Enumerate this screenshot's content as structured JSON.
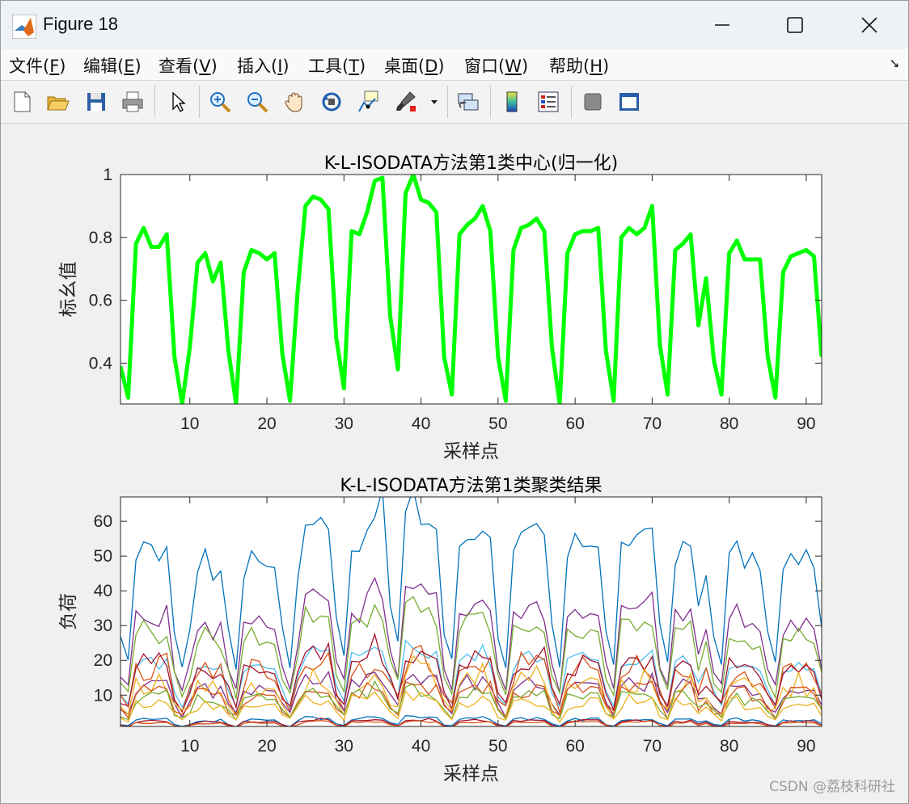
{
  "window": {
    "title": "Figure 18",
    "controls": {
      "minimize": "minimize",
      "maximize": "maximize",
      "close": "close"
    }
  },
  "menu": [
    {
      "label": "文件(",
      "key": "F",
      "tail": ")"
    },
    {
      "label": "编辑(",
      "key": "E",
      "tail": ")"
    },
    {
      "label": "查看(",
      "key": "V",
      "tail": ")"
    },
    {
      "label": "插入(",
      "key": "I",
      "tail": ")"
    },
    {
      "label": "工具(",
      "key": "T",
      "tail": ")"
    },
    {
      "label": "桌面(",
      "key": "D",
      "tail": ")"
    },
    {
      "label": "窗口(",
      "key": "W",
      "tail": ")"
    },
    {
      "label": "帮助(",
      "key": "H",
      "tail": ")"
    }
  ],
  "toolbar": [
    "new-figure-icon",
    "open-file-icon",
    "save-icon",
    "print-icon",
    "pointer-icon",
    "zoom-in-icon",
    "zoom-out-icon",
    "pan-icon",
    "rotate-3d-icon",
    "data-cursor-icon",
    "brush-icon",
    "link-plot-icon",
    "colorbar-icon",
    "legend-icon",
    "hide-plot-tools-icon",
    "show-plot-tools-icon"
  ],
  "watermark": "CSDN @荔枝科研社",
  "chart_data": [
    {
      "type": "line",
      "title": "K-L-ISODATA方法第1类中心(归一化)",
      "xlabel": "采样点",
      "ylabel": "标幺值",
      "xlim": [
        1,
        92
      ],
      "ylim": [
        0.27,
        1.0
      ],
      "xticks": [
        10,
        20,
        30,
        40,
        50,
        60,
        70,
        80,
        90
      ],
      "yticks": [
        0.4,
        0.6,
        0.8,
        1
      ],
      "ytick_labels": [
        "0.4",
        "0.6",
        "0.8",
        "1"
      ],
      "grid": false,
      "color": "#00ff00",
      "x": [
        1,
        2,
        3,
        4,
        5,
        6,
        7,
        8,
        9,
        10,
        11,
        12,
        13,
        14,
        15,
        16,
        17,
        18,
        19,
        20,
        21,
        22,
        23,
        24,
        25,
        26,
        27,
        28,
        29,
        30,
        31,
        32,
        33,
        34,
        35,
        36,
        37,
        38,
        39,
        40,
        41,
        42,
        43,
        44,
        45,
        46,
        47,
        48,
        49,
        50,
        51,
        52,
        53,
        54,
        55,
        56,
        57,
        58,
        59,
        60,
        61,
        62,
        63,
        64,
        65,
        66,
        67,
        68,
        69,
        70,
        71,
        72,
        73,
        74,
        75,
        76,
        77,
        78,
        79,
        80,
        81,
        82,
        83,
        84,
        85,
        86,
        87,
        88,
        89,
        90,
        91,
        92
      ],
      "values": [
        0.39,
        0.29,
        0.78,
        0.83,
        0.77,
        0.77,
        0.81,
        0.42,
        0.27,
        0.45,
        0.72,
        0.75,
        0.66,
        0.72,
        0.44,
        0.27,
        0.69,
        0.76,
        0.75,
        0.73,
        0.75,
        0.43,
        0.28,
        0.63,
        0.9,
        0.93,
        0.92,
        0.89,
        0.48,
        0.32,
        0.82,
        0.81,
        0.88,
        0.98,
        0.99,
        0.55,
        0.38,
        0.94,
        1.0,
        0.92,
        0.91,
        0.88,
        0.42,
        0.3,
        0.81,
        0.84,
        0.86,
        0.9,
        0.82,
        0.42,
        0.28,
        0.76,
        0.83,
        0.84,
        0.86,
        0.82,
        0.45,
        0.27,
        0.75,
        0.81,
        0.82,
        0.82,
        0.83,
        0.44,
        0.28,
        0.8,
        0.83,
        0.81,
        0.83,
        0.9,
        0.46,
        0.3,
        0.76,
        0.78,
        0.81,
        0.52,
        0.67,
        0.41,
        0.3,
        0.75,
        0.79,
        0.73,
        0.73,
        0.73,
        0.42,
        0.29,
        0.69,
        0.74,
        0.75,
        0.76,
        0.74,
        0.42
      ]
    },
    {
      "type": "line",
      "title": "K-L-ISODATA方法第1类聚类结果",
      "xlabel": "采样点",
      "ylabel": "负荷",
      "xlim": [
        1,
        92
      ],
      "ylim": [
        1,
        67
      ],
      "xticks": [
        10,
        20,
        30,
        40,
        50,
        60,
        70,
        80,
        90
      ],
      "yticks": [
        10,
        20,
        30,
        40,
        50,
        60
      ],
      "grid": false,
      "profile": [
        0.39,
        0.29,
        0.78,
        0.83,
        0.77,
        0.77,
        0.81,
        0.42,
        0.27,
        0.45,
        0.72,
        0.75,
        0.66,
        0.72,
        0.44,
        0.27,
        0.69,
        0.76,
        0.75,
        0.73,
        0.75,
        0.43,
        0.28,
        0.63,
        0.9,
        0.93,
        0.92,
        0.89,
        0.48,
        0.32,
        0.82,
        0.81,
        0.88,
        0.98,
        0.99,
        0.55,
        0.38,
        0.94,
        1.0,
        0.92,
        0.91,
        0.88,
        0.42,
        0.3,
        0.81,
        0.84,
        0.86,
        0.9,
        0.82,
        0.42,
        0.28,
        0.76,
        0.83,
        0.84,
        0.86,
        0.82,
        0.45,
        0.27,
        0.75,
        0.81,
        0.82,
        0.82,
        0.83,
        0.44,
        0.28,
        0.8,
        0.83,
        0.81,
        0.83,
        0.9,
        0.46,
        0.3,
        0.76,
        0.78,
        0.81,
        0.52,
        0.67,
        0.41,
        0.3,
        0.75,
        0.79,
        0.73,
        0.73,
        0.73,
        0.42,
        0.29,
        0.69,
        0.74,
        0.75,
        0.76,
        0.74,
        0.42
      ],
      "series": [
        {
          "color": "#0072bd",
          "scale": 66,
          "noise": 0.06
        },
        {
          "color": "#7e2f8e",
          "scale": 42,
          "noise": 0.1
        },
        {
          "color": "#77ac30",
          "scale": 36,
          "noise": 0.12
        },
        {
          "color": "#4dbeee",
          "scale": 25,
          "noise": 0.1
        },
        {
          "color": "#d95319",
          "scale": 22,
          "noise": 0.25
        },
        {
          "color": "#a2142f",
          "scale": 24,
          "noise": 0.22
        },
        {
          "color": "#7e2f8e",
          "scale": 16,
          "noise": 0.18
        },
        {
          "color": "#edb120",
          "scale": 17,
          "noise": 0.3
        },
        {
          "color": "#d95319",
          "scale": 14,
          "noise": 0.25
        },
        {
          "color": "#77ac30",
          "scale": 12,
          "noise": 0.2
        },
        {
          "color": "#edb120",
          "scale": 10,
          "noise": 0.25
        },
        {
          "color": "#0072bd",
          "scale": 3.8,
          "noise": 0.15
        },
        {
          "color": "#a2142f",
          "scale": 3.2,
          "noise": 0.15
        },
        {
          "color": "#d95319",
          "scale": 2.6,
          "noise": 0.15
        }
      ]
    }
  ]
}
